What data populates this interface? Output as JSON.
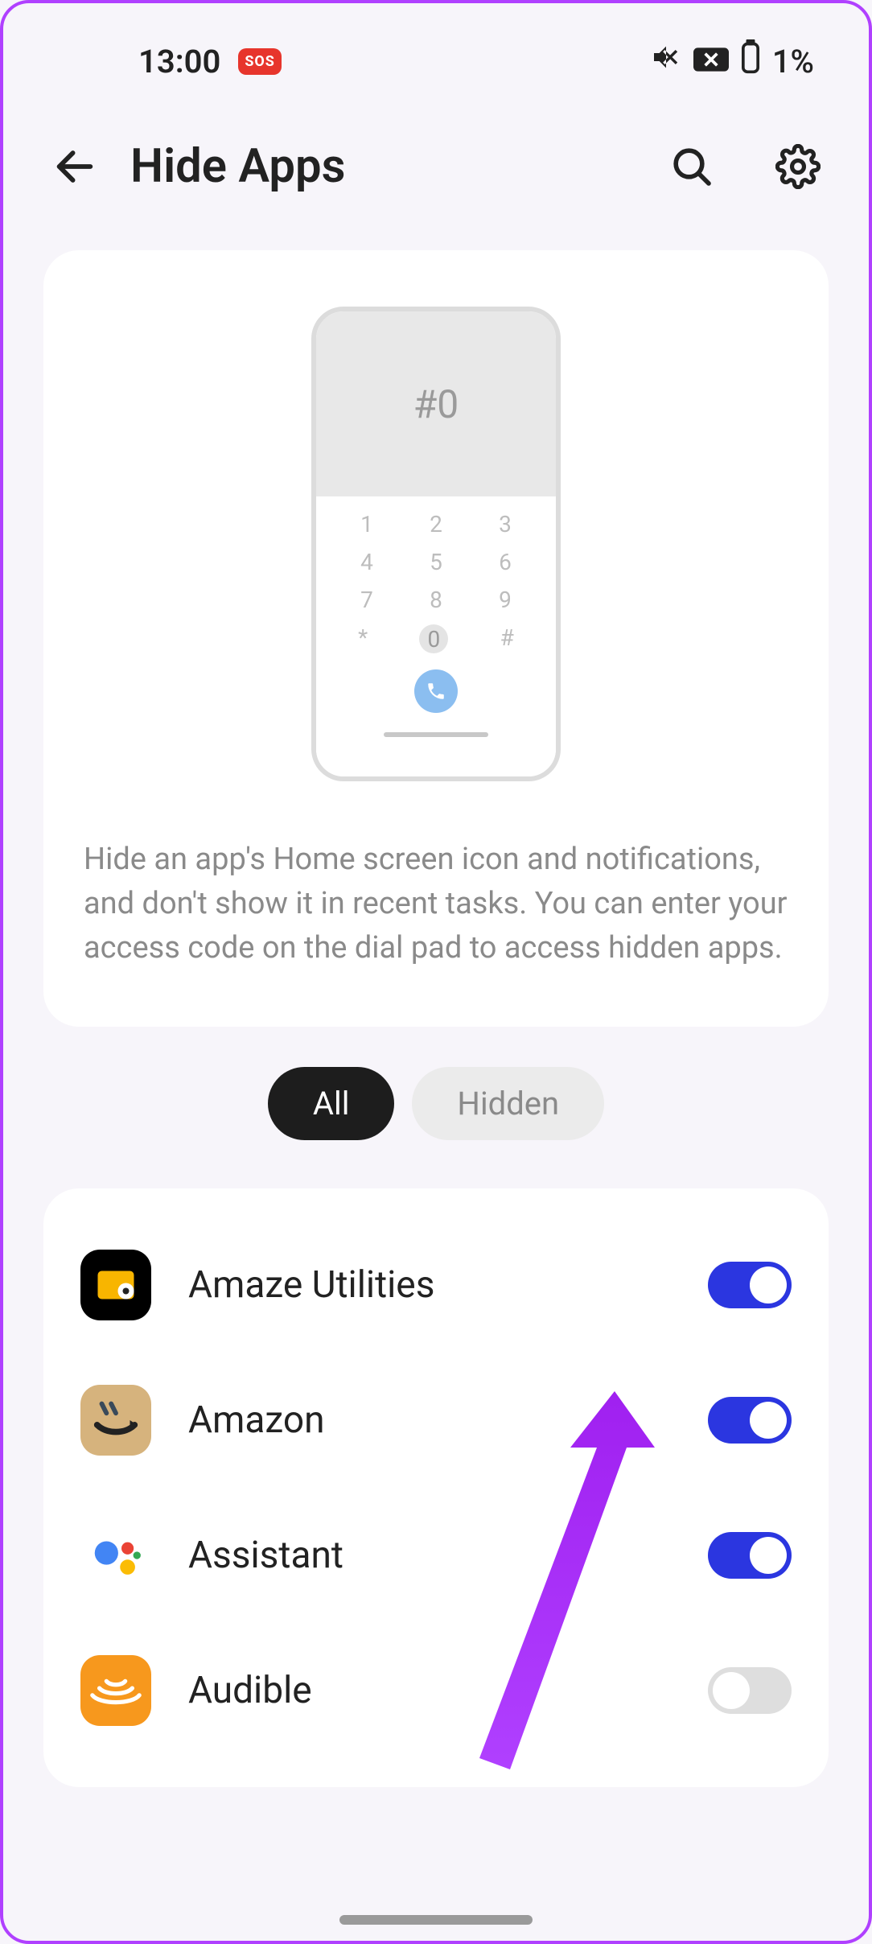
{
  "status": {
    "time": "13:00",
    "sos": "SOS",
    "battery": "1%"
  },
  "header": {
    "title": "Hide Apps"
  },
  "hero": {
    "code": "#0",
    "description": "Hide an app's Home screen icon and notifications, and don't show it in recent tasks. You can enter your access code on the dial pad to access hidden apps."
  },
  "tabs": {
    "all": "All",
    "hidden": "Hidden"
  },
  "apps": [
    {
      "name": "Amaze Utilities",
      "enabled": true,
      "icon": "amaze"
    },
    {
      "name": "Amazon",
      "enabled": true,
      "icon": "amazon"
    },
    {
      "name": "Assistant",
      "enabled": true,
      "icon": "assistant"
    },
    {
      "name": "Audible",
      "enabled": false,
      "icon": "audible"
    }
  ]
}
